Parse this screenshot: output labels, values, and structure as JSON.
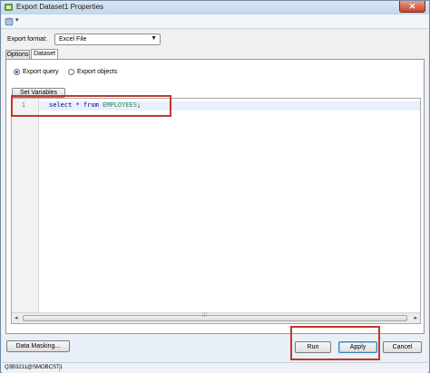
{
  "window": {
    "title": "Export Dataset1 Properties",
    "close_glyph": "✕"
  },
  "toolbar": {
    "icon": "db-icon",
    "dropdown_glyph": "▾"
  },
  "export_format": {
    "label": "Export format:",
    "value": "Excel File",
    "arrow": "▼"
  },
  "tabs": [
    {
      "label": "Options",
      "active": false
    },
    {
      "label": "Dataset",
      "active": true
    }
  ],
  "dataset": {
    "radios": [
      {
        "label": "Export query",
        "checked": true
      },
      {
        "label": "Export objects",
        "checked": false
      }
    ],
    "set_variables_label": "Set Variables"
  },
  "editor": {
    "line_number": "1",
    "code": {
      "keyword1": "select * from ",
      "table": "EMPLOYEES",
      "suffix": ";"
    },
    "scroll": {
      "left": "◂",
      "right": "▸",
      "grip": "⁞⁞⁞"
    }
  },
  "buttons": {
    "data_masking": "Data Masking...",
    "run": "Run",
    "apply": "Apply",
    "cancel": "Cancel"
  },
  "status": {
    "connection": "Q3B3211@SMOBCST1"
  },
  "colors": {
    "highlight_box": "#c0392b",
    "title_bar": "#c4d6ea"
  }
}
